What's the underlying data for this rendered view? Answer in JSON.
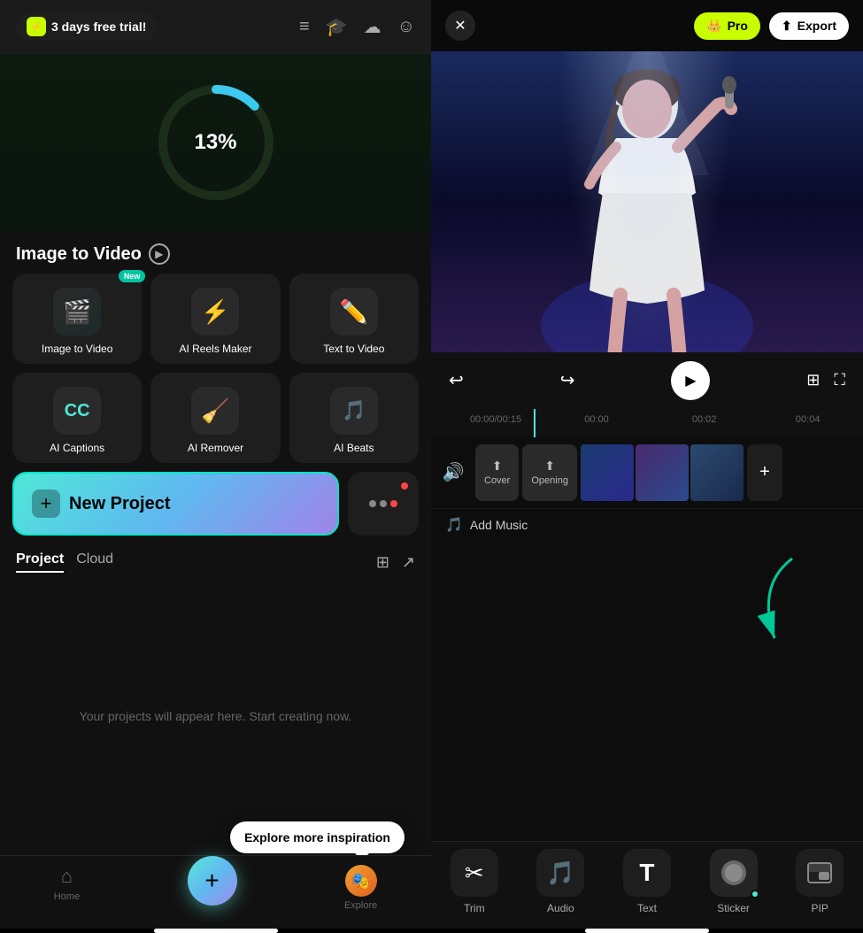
{
  "left": {
    "trial": {
      "icon": "⚡",
      "label": "3 days free trial!"
    },
    "topIcons": [
      "≡",
      "🎓",
      "☁",
      "☺"
    ],
    "progress": {
      "value": 13,
      "label": "13%",
      "circumference": 376
    },
    "sectionTitle": "Image to Video",
    "aiTools": [
      {
        "id": "image-to-video",
        "icon": "🎬",
        "label": "Image to Video",
        "badge": "New"
      },
      {
        "id": "ai-reels",
        "icon": "⚡",
        "label": "AI Reels Maker",
        "badge": ""
      },
      {
        "id": "text-to-video",
        "icon": "✏️",
        "label": "Text  to Video",
        "badge": ""
      },
      {
        "id": "ai-captions",
        "icon": "CC",
        "label": "AI Captions",
        "badge": ""
      },
      {
        "id": "ai-remover",
        "icon": "🧹",
        "label": "AI Remover",
        "badge": ""
      },
      {
        "id": "ai-beats",
        "icon": "🎵",
        "label": "AI Beats",
        "badge": ""
      }
    ],
    "newProjectLabel": "New Project",
    "moreDots": [
      "gray",
      "gray",
      "red"
    ],
    "tabs": [
      {
        "id": "project",
        "label": "Project",
        "active": true
      },
      {
        "id": "cloud",
        "label": "Cloud",
        "active": false
      }
    ],
    "emptyState": "Your projects will appear here. Start creating now.",
    "tooltip": "Explore more inspiration",
    "bottomNav": [
      {
        "id": "home",
        "icon": "⌂",
        "label": "Home"
      },
      {
        "id": "center",
        "icon": "+",
        "label": ""
      },
      {
        "id": "explore",
        "icon": "👤",
        "label": "Explore"
      }
    ]
  },
  "right": {
    "closeBtn": "✕",
    "proLabel": "Pro",
    "proIcon": "👑",
    "exportIcon": "⬆",
    "exportLabel": "Export",
    "controls": {
      "undo": "↩",
      "redo": "↪",
      "play": "▶",
      "grid": "⊞",
      "expand": "⛶"
    },
    "timeline": {
      "current": "00:00",
      "total": "00:15",
      "marks": [
        "00:00",
        "00:02",
        "00:04"
      ]
    },
    "track": {
      "muteIcon": "🔊",
      "coverLabel": "Cover",
      "openingLabel": "Opening",
      "addIcon": "+"
    },
    "addMusic": {
      "icon": "🎵",
      "label": "Add Music"
    },
    "tools": [
      {
        "id": "trim",
        "icon": "✂",
        "label": "Trim"
      },
      {
        "id": "audio",
        "icon": "🎵",
        "label": "Audio"
      },
      {
        "id": "text",
        "icon": "T",
        "label": "Text"
      },
      {
        "id": "sticker",
        "icon": "●",
        "label": "Sticker"
      },
      {
        "id": "pip",
        "icon": "⊡",
        "label": "PIP"
      }
    ]
  }
}
